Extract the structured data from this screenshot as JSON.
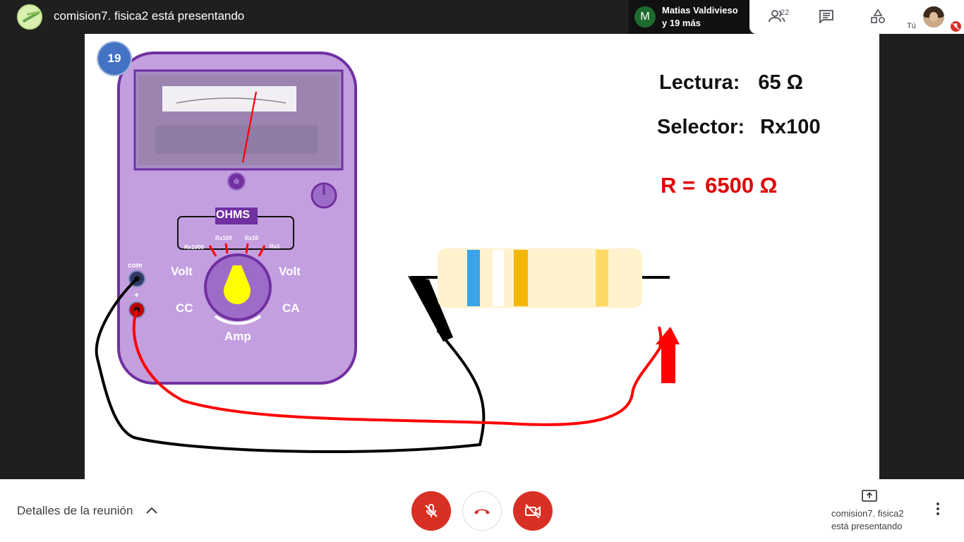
{
  "topbar": {
    "presenting_title": "comision7. fisica2 está presentando",
    "speaker": {
      "avatar_letter": "M",
      "name": "Matias Valdivieso",
      "more": "y 19 más"
    },
    "people_count": "22",
    "self_label": "Tú"
  },
  "slide": {
    "number": "19",
    "lectura_label": "Lectura:",
    "lectura_value": "65 Ω",
    "selector_label": "Selector:",
    "selector_value": "Rx100",
    "result_label": "R =",
    "result_value": "6500 Ω",
    "multimeter": {
      "ohms": "OHMS",
      "ranges": [
        "Rx1000",
        "Rx100",
        "Rx10",
        "Rx1"
      ],
      "volt_left": "Volt",
      "volt_right": "Volt",
      "cc": "CC",
      "ca": "CA",
      "amp": "Amp",
      "com": "com",
      "plus": "+"
    },
    "colors": {
      "meter_body": "#c39fe0",
      "meter_border": "#7030a0",
      "knob": "#ffff00",
      "red_lead": "#ff0000"
    }
  },
  "bottombar": {
    "meeting_details": "Detalles de la reunión",
    "presenter_line1": "comision7. fisica2",
    "presenter_line2": "está presentando"
  }
}
